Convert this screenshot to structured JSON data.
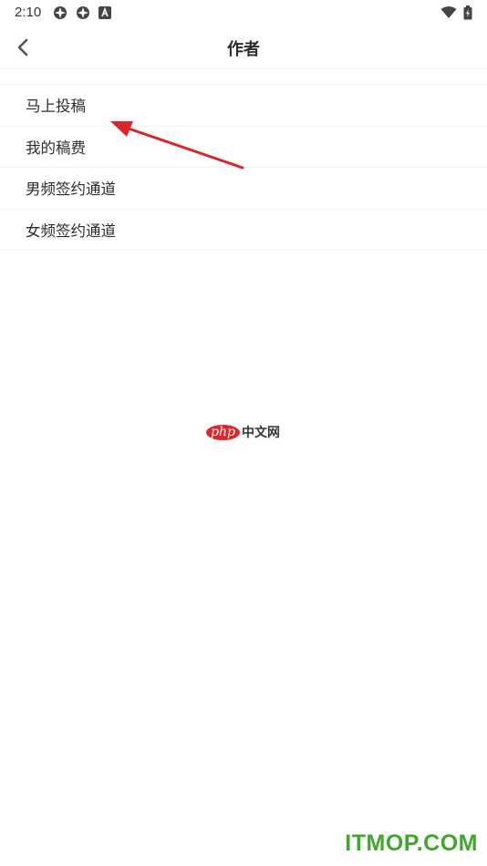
{
  "status_bar": {
    "time": "2:10",
    "icons": [
      "app-notification-icon",
      "app-notification-icon",
      "a-notification-icon",
      "wifi-icon",
      "battery-charging-icon"
    ]
  },
  "app_bar": {
    "back_icon": "chevron-left-icon",
    "title": "作者"
  },
  "menu": {
    "items": [
      {
        "label": "马上投稿"
      },
      {
        "label": "我的稿费"
      },
      {
        "label": "男频签约通道"
      },
      {
        "label": "女频签约通道"
      }
    ]
  },
  "annotation": {
    "arrow_color": "#d8262b"
  },
  "watermarks": {
    "center_logo": "php",
    "center_text": "中文网",
    "corner_text": "ITMOP.COM"
  },
  "colors": {
    "background": "#ffffff",
    "text": "#2c2c2c",
    "divider": "#f0f0f0",
    "corner_watermark": "#3fa82a"
  }
}
